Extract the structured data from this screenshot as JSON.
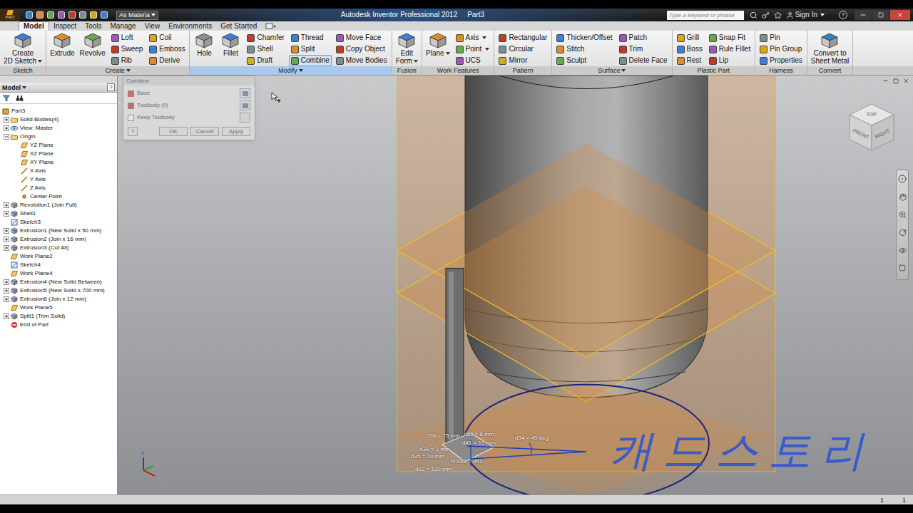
{
  "title_bar": {
    "badge": "PRO",
    "material": "As Materia",
    "title": "Autodesk Inventor Professional 2012",
    "document": "Part3",
    "search_placeholder": "Type a keyword or phrase",
    "sign_in": "Sign In",
    "help": "?"
  },
  "ribbon": {
    "tabs": [
      {
        "label": "Model",
        "selected": true
      },
      {
        "label": "Inspect",
        "selected": false
      },
      {
        "label": "Tools",
        "selected": false
      },
      {
        "label": "Manage",
        "selected": false
      },
      {
        "label": "View",
        "selected": false
      },
      {
        "label": "Environments",
        "selected": false
      },
      {
        "label": "Get Started",
        "selected": false
      }
    ],
    "panels": [
      {
        "label": "Sketch",
        "dropdown": false,
        "highlighted": false,
        "large": [
          {
            "lines": [
              "Create",
              "2D Sketch"
            ],
            "dropdown": true
          }
        ],
        "columns": []
      },
      {
        "label": "Create",
        "dropdown": true,
        "highlighted": false,
        "large": [
          {
            "lines": [
              "Extrude"
            ],
            "dropdown": false
          },
          {
            "lines": [
              "Revolve"
            ],
            "dropdown": false
          }
        ],
        "columns": [
          [
            {
              "label": "Loft",
              "dropdown": false,
              "active": false
            },
            {
              "label": "Sweep",
              "dropdown": false,
              "active": false
            },
            {
              "label": "Rib",
              "dropdown": false,
              "active": false
            }
          ],
          [
            {
              "label": "Coil",
              "dropdown": false,
              "active": false
            },
            {
              "label": "Emboss",
              "dropdown": false,
              "active": false
            },
            {
              "label": "Derive",
              "dropdown": false,
              "active": false
            }
          ]
        ]
      },
      {
        "label": "Modify",
        "dropdown": true,
        "highlighted": true,
        "large": [
          {
            "lines": [
              "Hole"
            ],
            "dropdown": false
          },
          {
            "lines": [
              "Fillet"
            ],
            "dropdown": false
          }
        ],
        "columns": [
          [
            {
              "label": "Chamfer",
              "dropdown": false,
              "active": false
            },
            {
              "label": "Shell",
              "dropdown": false,
              "active": false
            },
            {
              "label": "Draft",
              "dropdown": false,
              "active": false
            }
          ],
          [
            {
              "label": "Thread",
              "dropdown": false,
              "active": false
            },
            {
              "label": "Split",
              "dropdown": false,
              "active": false
            },
            {
              "label": "Combine",
              "dropdown": false,
              "active": true
            }
          ],
          [
            {
              "label": "Move Face",
              "dropdown": false,
              "active": false
            },
            {
              "label": "Copy Object",
              "dropdown": false,
              "active": false
            },
            {
              "label": "Move Bodies",
              "dropdown": false,
              "active": false
            }
          ]
        ]
      },
      {
        "label": "Fusion",
        "dropdown": false,
        "highlighted": false,
        "large": [
          {
            "lines": [
              "Edit",
              "Form"
            ],
            "dropdown": true
          }
        ],
        "columns": []
      },
      {
        "label": "Work Features",
        "dropdown": false,
        "highlighted": false,
        "large": [
          {
            "lines": [
              "Plane"
            ],
            "dropdown": true
          }
        ],
        "columns": [
          [
            {
              "label": "Axis",
              "dropdown": true,
              "active": false
            },
            {
              "label": "Point",
              "dropdown": true,
              "active": false
            },
            {
              "label": "UCS",
              "dropdown": false,
              "active": false
            }
          ]
        ]
      },
      {
        "label": "Pattern",
        "dropdown": false,
        "highlighted": false,
        "large": [],
        "columns": [
          [
            {
              "label": "Rectangular",
              "dropdown": false,
              "active": false
            },
            {
              "label": "Circular",
              "dropdown": false,
              "active": false
            },
            {
              "label": "Mirror",
              "dropdown": false,
              "active": false
            }
          ]
        ]
      },
      {
        "label": "Surface",
        "dropdown": true,
        "highlighted": false,
        "large": [],
        "columns": [
          [
            {
              "label": "Thicken/Offset",
              "dropdown": false,
              "active": false
            },
            {
              "label": "Stitch",
              "dropdown": false,
              "active": false
            },
            {
              "label": "Sculpt",
              "dropdown": false,
              "active": false
            }
          ],
          [
            {
              "label": "Patch",
              "dropdown": false,
              "active": false
            },
            {
              "label": "Trim",
              "dropdown": false,
              "active": false
            },
            {
              "label": "Delete Face",
              "dropdown": false,
              "active": false
            }
          ]
        ]
      },
      {
        "label": "Plastic Part",
        "dropdown": false,
        "highlighted": false,
        "large": [],
        "columns": [
          [
            {
              "label": "Grill",
              "dropdown": false,
              "active": false
            },
            {
              "label": "Boss",
              "dropdown": false,
              "active": false
            },
            {
              "label": "Rest",
              "dropdown": false,
              "active": false
            }
          ],
          [
            {
              "label": "Snap Fit",
              "dropdown": false,
              "active": false
            },
            {
              "label": "Rule Fillet",
              "dropdown": false,
              "active": false
            },
            {
              "label": "Lip",
              "dropdown": false,
              "active": false
            }
          ]
        ]
      },
      {
        "label": "Harness",
        "dropdown": false,
        "highlighted": false,
        "large": [],
        "columns": [
          [
            {
              "label": "Pin",
              "dropdown": false,
              "active": false
            },
            {
              "label": "Pin Group",
              "dropdown": false,
              "active": false
            },
            {
              "label": "Properties",
              "dropdown": false,
              "active": false
            }
          ]
        ]
      },
      {
        "label": "Convert",
        "dropdown": false,
        "highlighted": false,
        "large": [
          {
            "lines": [
              "Convert to",
              "Sheet Metal"
            ],
            "dropdown": false
          }
        ],
        "columns": []
      }
    ]
  },
  "browser": {
    "title": "Model",
    "help": "?",
    "items": [
      {
        "label": "Part3",
        "depth": 0,
        "kind": "part",
        "expandable": false,
        "expanded": false
      },
      {
        "label": "Solid Bodies(4)",
        "depth": 1,
        "kind": "folder",
        "expandable": true,
        "expanded": false
      },
      {
        "label": "View: Master",
        "depth": 1,
        "kind": "view",
        "expandable": true,
        "expanded": false
      },
      {
        "label": "Origin",
        "depth": 1,
        "kind": "folder",
        "expandable": true,
        "expanded": true
      },
      {
        "label": "YZ Plane",
        "depth": 2,
        "kind": "plane",
        "expandable": false,
        "expanded": false
      },
      {
        "label": "XZ Plane",
        "depth": 2,
        "kind": "plane",
        "expandable": false,
        "expanded": false
      },
      {
        "label": "XY Plane",
        "depth": 2,
        "kind": "plane",
        "expandable": false,
        "expanded": false
      },
      {
        "label": "X Axis",
        "depth": 2,
        "kind": "axis",
        "expandable": false,
        "expanded": false
      },
      {
        "label": "Y Axis",
        "depth": 2,
        "kind": "axis",
        "expandable": false,
        "expanded": false
      },
      {
        "label": "Z Axis",
        "depth": 2,
        "kind": "axis",
        "expandable": false,
        "expanded": false
      },
      {
        "label": "Center Point",
        "depth": 2,
        "kind": "point",
        "expandable": false,
        "expanded": false
      },
      {
        "label": "Revolution1 (Join Full)",
        "depth": 1,
        "kind": "feature",
        "expandable": true,
        "expanded": false
      },
      {
        "label": "Shell1",
        "depth": 1,
        "kind": "feature",
        "expandable": true,
        "expanded": false
      },
      {
        "label": "Sketch3",
        "depth": 1,
        "kind": "sketch",
        "expandable": false,
        "expanded": false
      },
      {
        "label": "Extrusion1 (New Solid x 50 mm)",
        "depth": 1,
        "kind": "feature",
        "expandable": true,
        "expanded": false
      },
      {
        "label": "Extrusion2 (Join x 16 mm)",
        "depth": 1,
        "kind": "feature",
        "expandable": true,
        "expanded": false
      },
      {
        "label": "Extrusion3 (Cut All)",
        "depth": 1,
        "kind": "feature",
        "expandable": true,
        "expanded": false
      },
      {
        "label": "Work Plane2",
        "depth": 1,
        "kind": "plane",
        "expandable": false,
        "expanded": false
      },
      {
        "label": "Sketch4",
        "depth": 1,
        "kind": "sketch",
        "expandable": false,
        "expanded": false
      },
      {
        "label": "Work Plane4",
        "depth": 1,
        "kind": "plane",
        "expandable": false,
        "expanded": false
      },
      {
        "label": "Extrusion4 (New Solid Between)",
        "depth": 1,
        "kind": "feature",
        "expandable": true,
        "expanded": false
      },
      {
        "label": "Extrusion5 (New Solid x 700 mm)",
        "depth": 1,
        "kind": "feature",
        "expandable": true,
        "expanded": false
      },
      {
        "label": "Extrusion6 (Join x 12 mm)",
        "depth": 1,
        "kind": "feature",
        "expandable": true,
        "expanded": false
      },
      {
        "label": "Work Plane5",
        "depth": 1,
        "kind": "plane",
        "expandable": false,
        "expanded": false
      },
      {
        "label": "Split1 (Trim Solid)",
        "depth": 1,
        "kind": "feature",
        "expandable": true,
        "expanded": false
      },
      {
        "label": "End of Part",
        "depth": 1,
        "kind": "end",
        "expandable": false,
        "expanded": false
      }
    ]
  },
  "dialog": {
    "title": "Combine",
    "rows": [
      {
        "label": "Base"
      },
      {
        "label": "Toolbody (0)"
      }
    ],
    "checkbox": {
      "label": "Keep Toolbody",
      "checked": false
    },
    "help": "?",
    "buttons": [
      "OK",
      "Cancel",
      "Apply"
    ]
  },
  "viewport": {
    "dimensions": [
      {
        "text": "d36 = 75 mm"
      },
      {
        "text": "d39 = 6 mm"
      },
      {
        "text": "d41 = 10 mm"
      },
      {
        "text": "d38 = 2 mm"
      },
      {
        "text": "d35 = 20 mm"
      },
      {
        "text": "fx:d42 = d41"
      },
      {
        "text": "d33 = 120 mm"
      },
      {
        "text": "d34 = 45 deg"
      }
    ],
    "view_cube": {
      "top": "TOP",
      "front": "FRONT",
      "right": "RIGHT"
    },
    "axis_label": "z",
    "watermark": "캐드스토리"
  },
  "status_bar": {
    "values": [
      "1",
      "1"
    ]
  }
}
